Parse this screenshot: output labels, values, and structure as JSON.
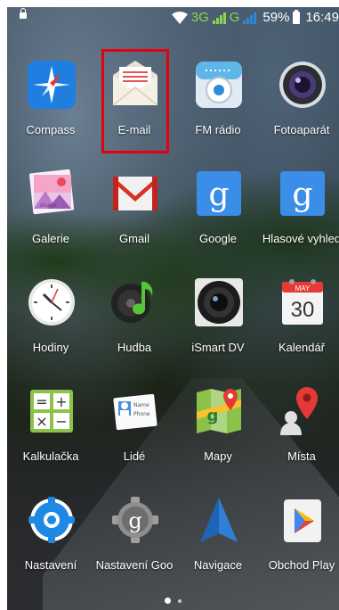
{
  "status": {
    "network1": "3G",
    "network2": "G",
    "battery": "59%",
    "time": "16:49",
    "colors": {
      "network": "#8ad64a",
      "signal2": "#2e86d9"
    }
  },
  "apps": [
    {
      "label": "Compass",
      "icon": "compass-icon"
    },
    {
      "label": "E-mail",
      "icon": "email-icon",
      "highlighted": true
    },
    {
      "label": "FM rádio",
      "icon": "fm-radio-icon"
    },
    {
      "label": "Fotoaparát",
      "icon": "camera-icon"
    },
    {
      "label": "Galerie",
      "icon": "gallery-icon",
      "badge": "Image"
    },
    {
      "label": "Gmail",
      "icon": "gmail-icon"
    },
    {
      "label": "Google",
      "icon": "google-icon"
    },
    {
      "label": "Hlasové vyhled",
      "icon": "voice-search-icon"
    },
    {
      "label": "Hodiny",
      "icon": "clock-icon"
    },
    {
      "label": "Hudba",
      "icon": "music-icon"
    },
    {
      "label": "iSmart DV",
      "icon": "ismart-dv-icon"
    },
    {
      "label": "Kalendář",
      "icon": "calendar-icon",
      "month": "MAY",
      "day": "30"
    },
    {
      "label": "Kalkulačka",
      "icon": "calculator-icon"
    },
    {
      "label": "Lidé",
      "icon": "contacts-icon",
      "card_name": "Name",
      "card_phone": "Phone"
    },
    {
      "label": "Mapy",
      "icon": "maps-icon"
    },
    {
      "label": "Místa",
      "icon": "places-icon"
    },
    {
      "label": "Nastavení",
      "icon": "settings-icon"
    },
    {
      "label": "Nastavení Goo",
      "icon": "google-settings-icon"
    },
    {
      "label": "Navigace",
      "icon": "navigation-icon"
    },
    {
      "label": "Obchod Play",
      "icon": "play-store-icon"
    }
  ],
  "highlight_color": "#e4000f"
}
